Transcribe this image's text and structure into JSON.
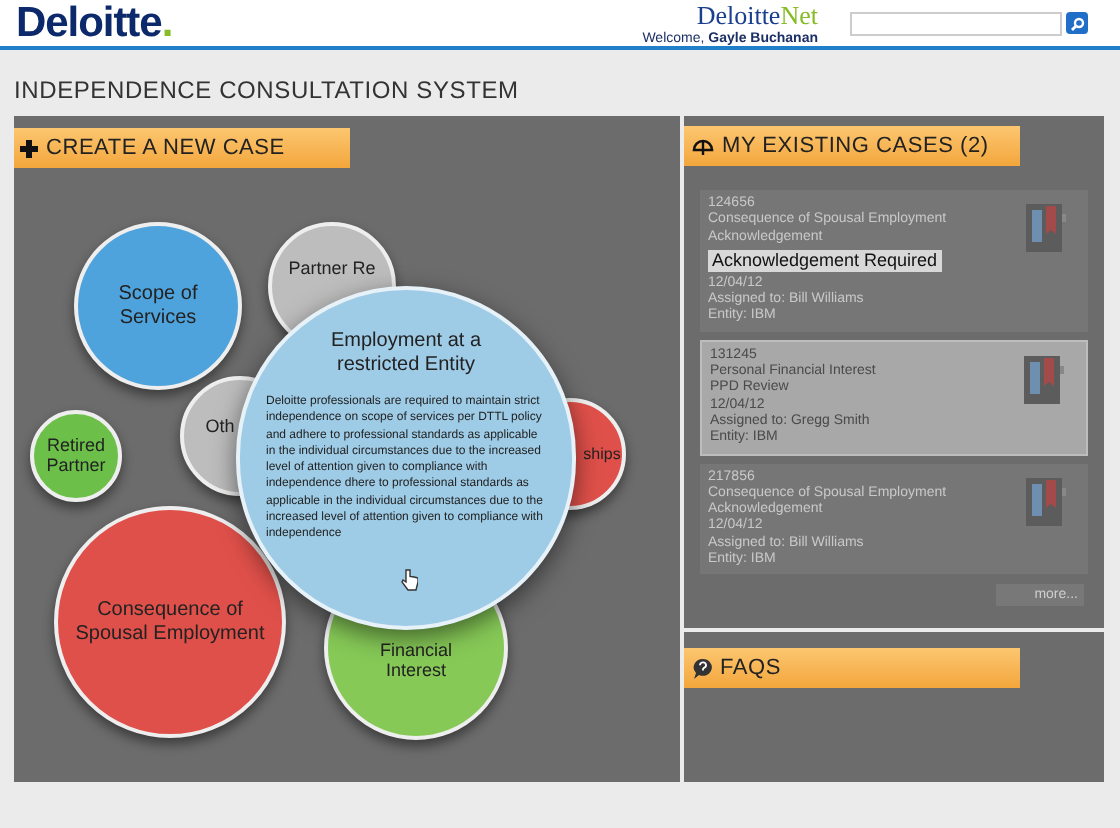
{
  "header": {
    "logo": "Deloitte",
    "logo_dot": ".",
    "portal_name": "Deloitte",
    "portal_suffix": "Net",
    "welcome": "Welcome, **Gayle Buchanan**"
  },
  "page_title": "INDEPENDENCE CONSULTATION SYSTEM",
  "create_panel": {
    "heading": "CREATE A NEW CASE",
    "bubbles": [
      {
        "label": "Scope of Services",
        "color": "#4fa3dc"
      },
      {
        "label": "Partner Re",
        "color": "#bdbdbd"
      },
      {
        "label": "Retired Partner",
        "color": "#6cc04a"
      },
      {
        "label": "Oth",
        "color": "#bdbdbd"
      },
      {
        "label": "ships",
        "color": "#e0504a"
      },
      {
        "label": "Consequence of Spousal Employment",
        "color": "#e0504a"
      },
      {
        "label": "Financial Interest",
        "color": "#86c957"
      }
    ],
    "focus_bubble": {
      "title": "Employment at a restricted Entity",
      "text": "Deloitte professionals are required to maintain strict independence on scope of services  per DTTL policy and adhere to professional standards as applicable in the individual circumstances  due to the increased level of attention given to compliance with independence dhere to professional standards as applicable in the individual circumstances due to the increased level of attention given to compliance with independence"
    }
  },
  "cases_panel": {
    "heading": "MY EXISTING CASES (2)",
    "cases": [
      {
        "id": "124656",
        "lines": [
          "Consequence of Spousal Employment",
          "Acknowledgement"
        ],
        "badge": "Acknowledgement Required",
        "date": "12/04/12",
        "assigned": "Assigned to:  Bill Williams",
        "entity": "Entity:  IBM",
        "selected": false
      },
      {
        "id": "131245",
        "lines": [
          "Personal Financial Interest",
          "PPD Review"
        ],
        "date": "12/04/12",
        "assigned": "Assigned to:  Gregg Smith",
        "entity": "Entity:  IBM",
        "selected": true
      },
      {
        "id": "217856",
        "lines": [
          "Consequence of Spousal Employment",
          "Acknowledgement"
        ],
        "date": "12/04/12",
        "assigned": "Assigned to:  Bill Williams",
        "entity": "Entity:  IBM",
        "selected": false
      }
    ],
    "more": "more..."
  },
  "faq_panel": {
    "heading": "FAQS"
  }
}
